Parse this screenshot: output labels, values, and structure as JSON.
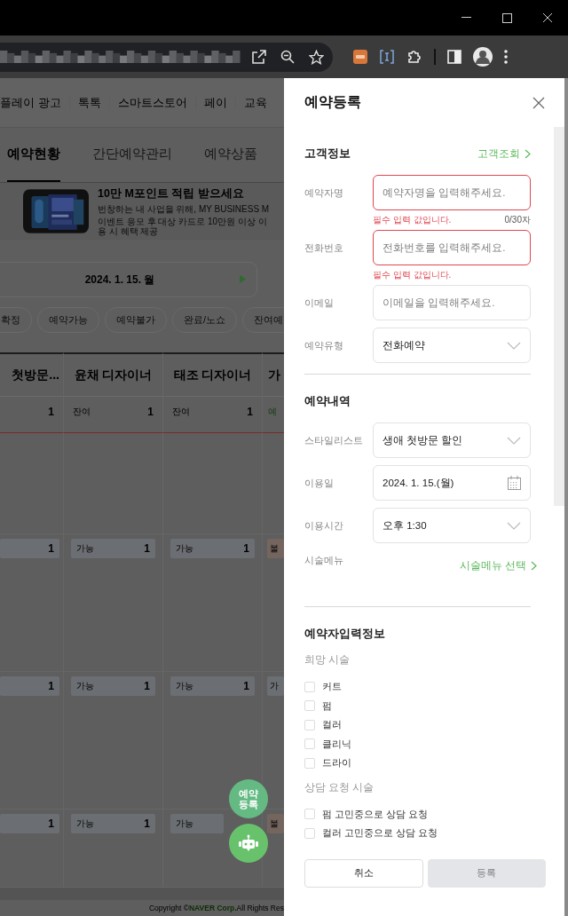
{
  "background": {
    "nav": [
      "플레이 광고",
      "톡톡",
      "스마트스토어",
      "페이",
      "교육"
    ],
    "tabs": [
      {
        "label": "예약현황",
        "selected": true
      },
      {
        "label": "간단예약관리",
        "selected": false
      },
      {
        "label": "예약상품",
        "selected": false
      }
    ],
    "banner": {
      "title": "10만 M포인트 적립 받으세요",
      "subtitle": "번창하는 내 사업을 위해, MY BUSINESS M",
      "note": "이벤트 응모 후 대상 카드로 10만원 이상 이용 시 혜택 제공"
    },
    "date": "2024. 1. 15. 월",
    "chips": [
      "확정",
      "예약가능",
      "예약불가",
      "완료/노쇼",
      "잔여예"
    ],
    "table": {
      "columns": [
        "첫방문...",
        "윤채 디자이너",
        "태조 디자이너",
        "가"
      ],
      "summary": [
        {
          "count": "1"
        },
        {
          "label": "잔여",
          "count": "1"
        },
        {
          "label": "잔여",
          "count": "1"
        },
        {
          "label": "예"
        }
      ],
      "slots": [
        [
          {
            "count": "1",
            "kind": "open"
          },
          {
            "label": "가능",
            "count": "1",
            "kind": "open"
          },
          {
            "label": "가능",
            "count": "1",
            "kind": "open"
          },
          {
            "label": "불",
            "kind": "closed"
          }
        ],
        [
          {
            "count": "1",
            "kind": "open"
          },
          {
            "label": "가능",
            "count": "1",
            "kind": "open"
          },
          {
            "label": "가능",
            "count": "1",
            "kind": "open"
          },
          {
            "label": "가",
            "kind": "open"
          }
        ],
        [
          {
            "count": "1",
            "kind": "open"
          },
          {
            "label": "가능",
            "count": "1",
            "kind": "open"
          },
          {
            "label": "가능",
            "kind": "open"
          },
          {
            "label": "불",
            "kind": "closed"
          }
        ]
      ]
    },
    "footer": {
      "prefix": "Copyright © ",
      "brand": "NAVER Corp.",
      "suffix": " All Rights Res"
    },
    "fabs": [
      {
        "kind": "text",
        "label": "예약\n등록"
      },
      {
        "kind": "robot"
      }
    ]
  },
  "panel": {
    "title": "예약등록",
    "sections": [
      {
        "title": "고객정보",
        "link": "고객조회",
        "fields": [
          {
            "label": "예약자명",
            "kind": "text",
            "placeholder": "예약자명을 입력해주세요.",
            "error": "필수 입력 값입니다.",
            "counter": "0/30자"
          },
          {
            "label": "전화번호",
            "kind": "text",
            "placeholder": "전화번호를 입력해주세요.",
            "error": "필수 입력 값입니다."
          },
          {
            "label": "이메일",
            "kind": "text",
            "placeholder": "이메일을 입력해주세요."
          },
          {
            "label": "예약유형",
            "kind": "select",
            "value": "전화예약"
          }
        ]
      },
      {
        "title": "예약내역",
        "fields": [
          {
            "label": "스타일리스트",
            "kind": "select",
            "value": "생애 첫방문 할인"
          },
          {
            "label": "이용일",
            "kind": "date",
            "value": "2024. 1. 15.(월)"
          },
          {
            "label": "이용시간",
            "kind": "select",
            "value": "오후 1:30"
          },
          {
            "label": "시술메뉴",
            "kind": "link",
            "value": "시술메뉴 선택"
          }
        ]
      },
      {
        "title": "예약자입력정보",
        "groups": [
          {
            "title": "희망 시술",
            "options": [
              {
                "label": "커트",
                "checked": false
              },
              {
                "label": "펌",
                "checked": false
              },
              {
                "label": "컬러",
                "checked": false
              },
              {
                "label": "클리닉",
                "checked": false
              },
              {
                "label": "드라이",
                "checked": false
              }
            ]
          },
          {
            "title": "상담 요청 시술",
            "options": [
              {
                "label": "펌 고민중으로 상담 요청",
                "checked": false
              },
              {
                "label": "컬러 고민중으로 상담 요청",
                "checked": false
              }
            ]
          }
        ]
      }
    ],
    "buttons": [
      {
        "label": "취소",
        "disabled": false
      },
      {
        "label": "등록",
        "disabled": true
      }
    ]
  }
}
